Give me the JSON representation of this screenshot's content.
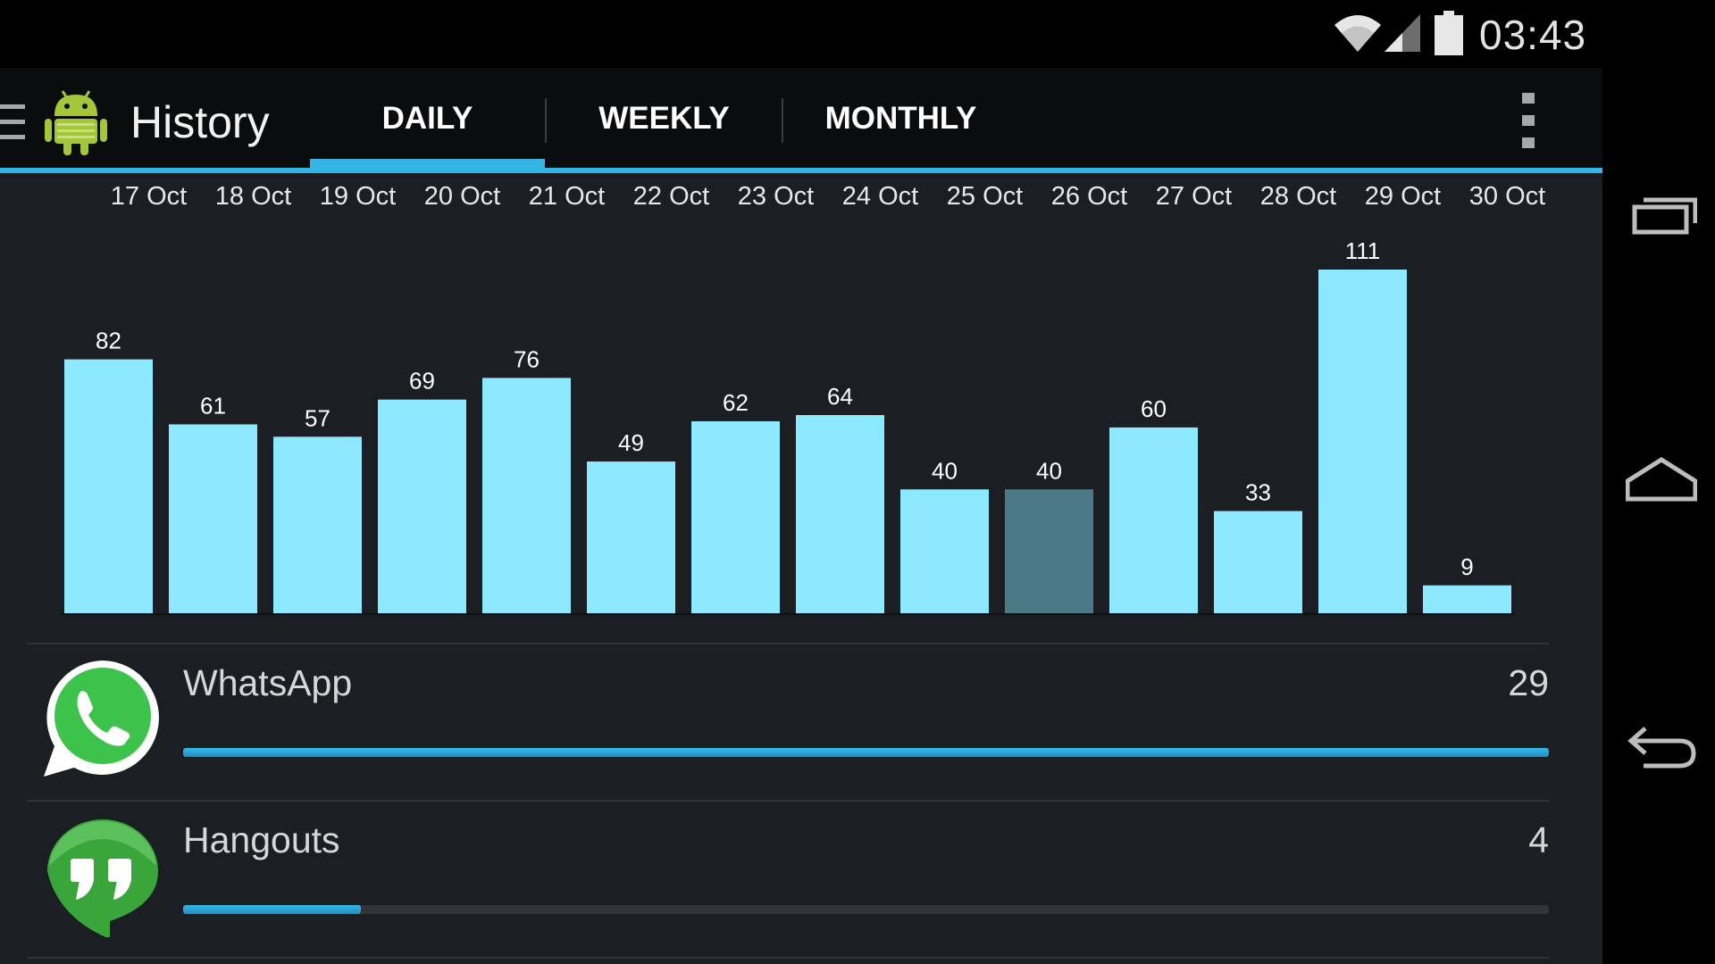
{
  "status_bar": {
    "time": "03:43",
    "icons": [
      "wifi-icon",
      "signal-icon",
      "battery-icon"
    ]
  },
  "action_bar": {
    "title": "History",
    "tabs": [
      {
        "label": "DAILY",
        "selected": true
      },
      {
        "label": "WEEKLY",
        "selected": false
      },
      {
        "label": "MONTHLY",
        "selected": false
      }
    ],
    "icons": [
      "drawer-icon",
      "android-icon",
      "overflow-menu-icon"
    ]
  },
  "colors": {
    "accent": "#33b5e5",
    "bar": "#8de9ff",
    "bar_selected": "#4b7a86",
    "background": "#1b1f24"
  },
  "chart_data": {
    "type": "bar",
    "categories": [
      "17 Oct",
      "18 Oct",
      "19 Oct",
      "20 Oct",
      "21 Oct",
      "22 Oct",
      "23 Oct",
      "24 Oct",
      "25 Oct",
      "26 Oct",
      "27 Oct",
      "28 Oct",
      "29 Oct",
      "30 Oct"
    ],
    "values": [
      82,
      61,
      57,
      69,
      76,
      49,
      62,
      64,
      40,
      40,
      60,
      33,
      111,
      9
    ],
    "selected_index": 9,
    "title": "",
    "xlabel": "",
    "ylabel": "",
    "ylim": [
      0,
      111
    ],
    "grid": false
  },
  "apps": [
    {
      "name": "WhatsApp",
      "count": "29",
      "progress": 1.0,
      "icon": "whatsapp-icon"
    },
    {
      "name": "Hangouts",
      "count": "4",
      "progress": 0.13,
      "icon": "hangouts-icon"
    }
  ],
  "nav_bar": {
    "buttons": [
      "recents-icon",
      "home-icon",
      "back-icon"
    ]
  }
}
